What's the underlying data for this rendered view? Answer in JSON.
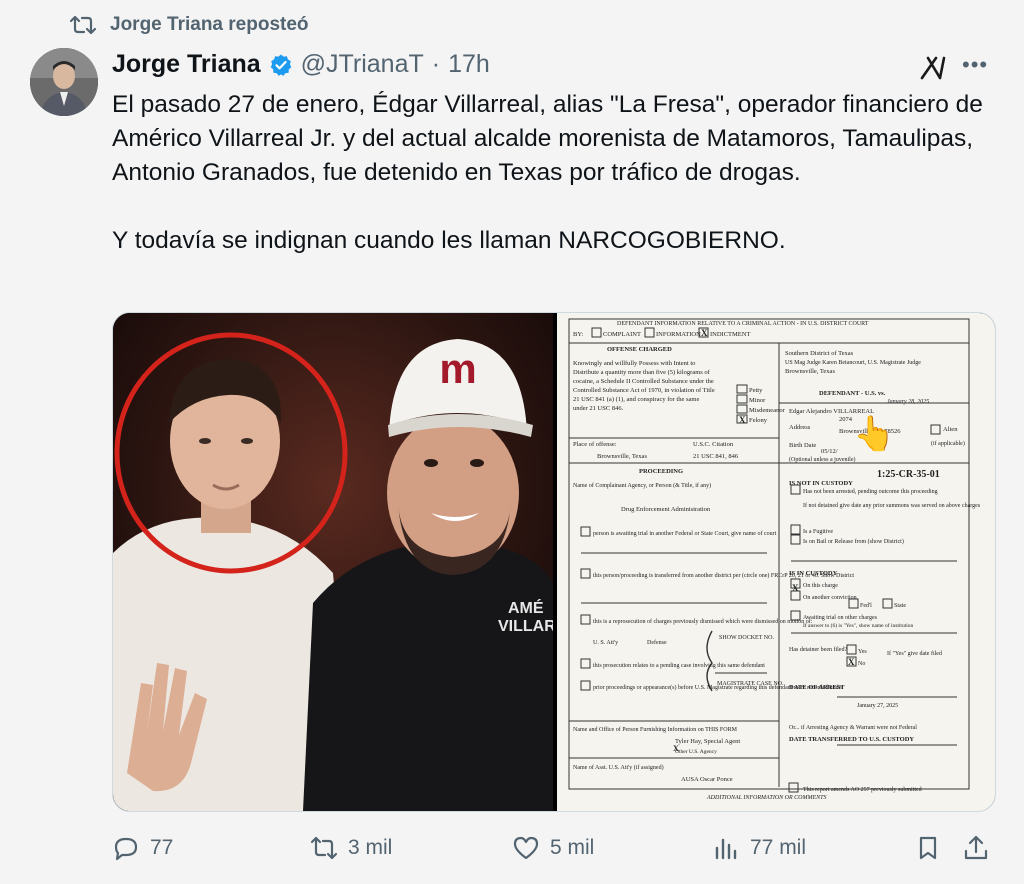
{
  "repost": {
    "label": "Jorge Triana reposteó",
    "icon": "repost-icon"
  },
  "author": {
    "name": "Jorge Triana",
    "handle": "@JTrianaT",
    "separator": "·",
    "time": "17h",
    "verified_color": "#1d9bf0"
  },
  "tweet": {
    "paragraph1": "El pasado 27 de enero, Édgar Villarreal, alias \"La Fresa\", operador financiero de Américo Villarreal Jr. y del actual alcalde morenista de Matamoros, Tamaulipas, Antonio Granados, fue detenido en Texas por tráfico de drogas.",
    "paragraph2": "Y todavía se indignan cuando les llaman NARCOGOBIERNO."
  },
  "media": {
    "photo_cap_letter": "m",
    "shirt_text_1": "AMÉ",
    "shirt_text_2": "VILLARRE",
    "document": {
      "title": "DEFENDANT INFORMATION RELATIVE TO A CRIMINAL ACTION - IN U.S. DISTRICT COURT",
      "by_label": "BY:",
      "complaint": "COMPLAINT",
      "information": "INFORMATION",
      "indictment": "INDICTMENT",
      "offense_charged": "OFFENSE CHARGED",
      "offense_text": [
        "Knowingly and willfully Possess with Intent to",
        "Distribute a quantity more than five (5) kilograms of",
        "cocaine, a Schedule II Controlled Substance under the",
        "Controlled Substance Act of 1970, in violation of Title",
        "21 USC 841 (a) (1), and conspiracy for the same",
        "under 21 USC 846."
      ],
      "petty": "Petty",
      "minor": "Minor",
      "misdemeanor": "Misdemeanor",
      "felony": "Felony",
      "district": "Southern District of Texas",
      "judge": "US Mag Judge Karen Betancourt, U.S. Magistrate Judge",
      "city": "Brownsville, Texas",
      "defendant_label": "DEFENDANT - U.S. vs.",
      "date_right": "January 28, 2025",
      "defendant_name": "Edgar Alejandro VILLARREAL",
      "address_label": "Address",
      "address1": "2074",
      "address2": "Brownsville, TX 78526",
      "alien": "Alien",
      "if_applicable": "(if applicable)",
      "birth_label": "Birth Date",
      "birth_value": "05/12/",
      "optional": "(Optional unless a juvenile)",
      "place_label": "Place of offense:",
      "place_value": "Brownsville, Texas",
      "usc_label": "U.S.C. Citation",
      "usc_value": "21 USC 841, 846",
      "proceeding": "PROCEEDING",
      "complainant_label": "Name of Complainant Agency, or Person (& Title, if any)",
      "agency": "Drug Enforcement Administration",
      "awaiting": "person is awaiting trial in another Federal or State Court, give name of court",
      "transferred": "this person/proceeding is transferred from another district per (circle one) FRCrP 20, 21 or 40. Show District",
      "reprosecution": "this is a reprosecution of charges previously dismissed which were dismissed on motion of:",
      "us_atty": "U. S. Att'y",
      "defense": "Defense",
      "show_docket": "SHOW DOCKET NO.",
      "pending": "this prosecution relates to a pending case involving this same defendant",
      "prior": "prior proceedings or appearance(s) before U.S. Magistrate regarding this defendant were recorded under",
      "magistrate_case": "MAGISTRATE CASE NO.",
      "furnishing": "Name and Office of Person Furnishing Information on THIS FORM",
      "agent": "Tyler Hay, Special Agent",
      "other_agency": "Other U.S. Agency",
      "asst_label": "Name of Asst. U.S. Att'y (if assigned)",
      "ausa": "AUSA Oscar Ponce",
      "additional": "ADDITIONAL INFORMATION OR COMMENTS",
      "case_no": "1:25-CR-35-01",
      "not_in_custody": "IS NOT IN CUSTODY",
      "not_arrested": "Has not been arrested, pending outcome this proceeding",
      "not_detained": "If not detained give date any prior summons was served on above charges",
      "fugitive": "Is a Fugitive",
      "bail": "Is on Bail or Release from (show District)",
      "in_custody": "IS IN CUSTODY",
      "this_charge": "On this charge",
      "another": "On another conviction",
      "fedl": "Fed'l",
      "state": "State",
      "awaiting_other": "Awaiting trial on other charges",
      "if_yes": "If answer to (6) is \"Yes\", show name of institution",
      "detainer": "Has detainer been filed?",
      "yes": "Yes",
      "no": "No",
      "if_yes_give": "If \"Yes\" give date filed",
      "date_of_arrest": "DATE OF ARREST",
      "arrest_date": "January 27, 2025",
      "or_if": "Or... if Arresting Agency & Warrant were not Federal",
      "date_transferred": "DATE TRANSFERRED TO U.S. CUSTODY",
      "amends": "This report amends AO 257 previously submitted",
      "pointer": "👆"
    }
  },
  "actions": {
    "replies": "77",
    "reposts": "3 mil",
    "likes": "5 mil",
    "views": "77 mil"
  }
}
